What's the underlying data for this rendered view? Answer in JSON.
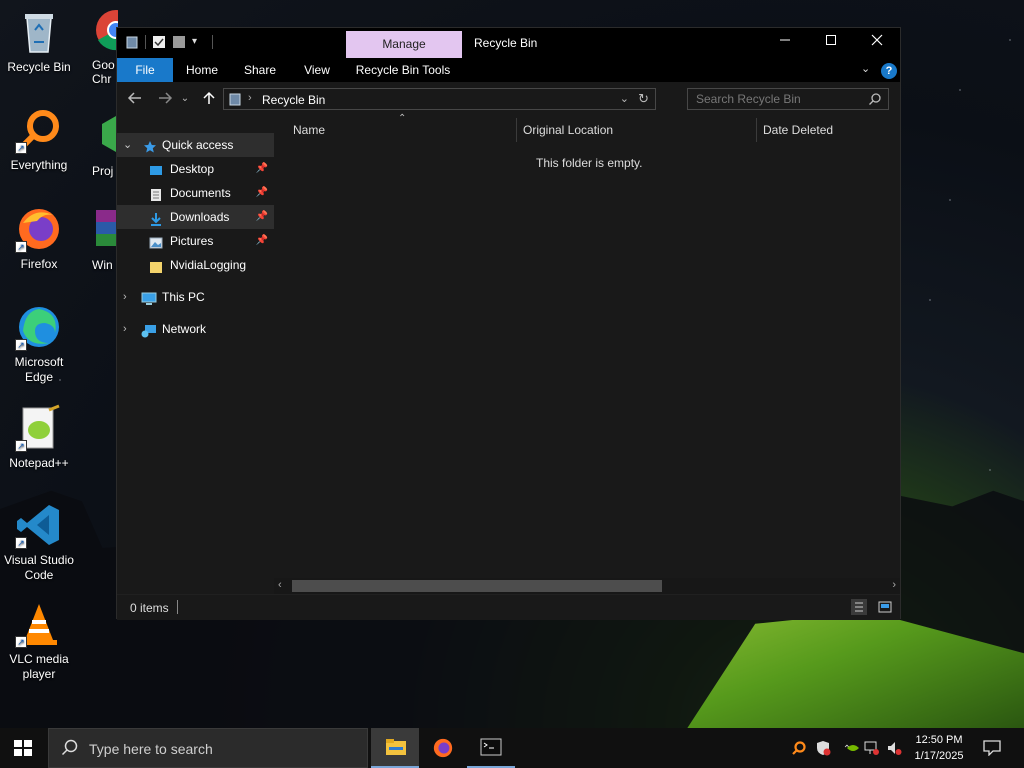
{
  "desktop": {
    "icons": [
      {
        "label": "Recycle Bin",
        "icon": "recycle-bin-icon"
      },
      {
        "label": "Everything",
        "icon": "everything-search-icon"
      },
      {
        "label": "Firefox",
        "icon": "firefox-icon"
      },
      {
        "label": "Microsoft Edge",
        "icon": "edge-icon"
      },
      {
        "label": "Notepad++",
        "icon": "notepadpp-icon"
      },
      {
        "label": "Visual Studio Code",
        "icon": "vscode-icon"
      },
      {
        "label": "VLC media player",
        "icon": "vlc-icon"
      }
    ],
    "partial_icons": [
      {
        "label": "Goo Chr",
        "icon": "chrome-icon"
      },
      {
        "label": "Proj",
        "icon": "project-icon"
      },
      {
        "label": "Win",
        "icon": "winrar-icon"
      }
    ]
  },
  "window": {
    "title": "Recycle Bin",
    "manage_tab": "Manage",
    "ribbon_tabs": [
      "File",
      "Home",
      "Share",
      "View",
      "Recycle Bin Tools"
    ],
    "address": "Recycle Bin",
    "search_placeholder": "Search Recycle Bin",
    "nav": {
      "quick_access": "Quick access",
      "pinned": [
        "Desktop",
        "Documents",
        "Downloads",
        "Pictures"
      ],
      "other": "NvidiaLogging",
      "this_pc": "This PC",
      "network": "Network"
    },
    "columns": [
      "Name",
      "Original Location",
      "Date Deleted"
    ],
    "empty_message": "This folder is empty.",
    "status": "0 items"
  },
  "taskbar": {
    "search_placeholder": "Type here to search",
    "time": "12:50 PM",
    "date": "1/17/2025"
  },
  "colors": {
    "file_tab": "#1979ca",
    "manage_tab": "#e3c6f0",
    "accent": "#4aa0ff"
  }
}
